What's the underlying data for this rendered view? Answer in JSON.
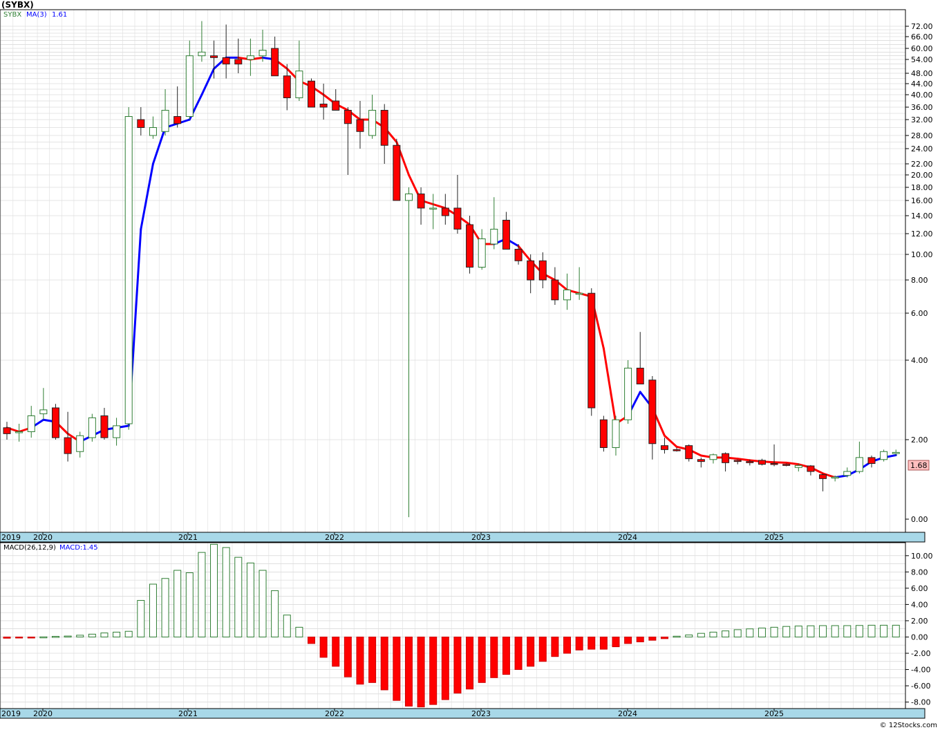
{
  "header": {
    "title": "(SYBX)"
  },
  "footer": {
    "copyright": "© 12Stocks.com"
  },
  "colors": {
    "up": "#2e7d32",
    "down": "#ff0000",
    "ma_up": "#0000ff",
    "ma_down": "#ff0000",
    "price_tag_bg": "#ffc0c0",
    "axis_band": "#a8d8e8",
    "grid": "#cccccc"
  },
  "chart_data": [
    {
      "type": "candlestick",
      "legend_symbol": "SYBX",
      "legend_ma_label": "MA(3)",
      "legend_ma_value": "1.61",
      "last_price_label": "1.68",
      "y_tick_labels": [
        "72.00",
        "66.00",
        "60.00",
        "54.00",
        "48.00",
        "44.00",
        "40.00",
        "36.00",
        "32.00",
        "28.00",
        "24.00",
        "22.00",
        "20.00",
        "18.00",
        "16.00",
        "14.00",
        "12.00",
        "10.00",
        "8.00",
        "6.00",
        "4.00",
        "2.00",
        "0.00"
      ],
      "x_tick_labels": [
        "2019",
        "2020",
        "2021",
        "2022",
        "2023",
        "2024",
        "2025"
      ],
      "grid": true,
      "candles": [
        {
          "o": 2.3,
          "h": 2.45,
          "l": 2.0,
          "c": 2.15
        },
        {
          "o": 2.18,
          "h": 2.4,
          "l": 1.95,
          "c": 2.2
        },
        {
          "o": 2.2,
          "h": 2.85,
          "l": 2.05,
          "c": 2.6
        },
        {
          "o": 2.65,
          "h": 3.3,
          "l": 2.5,
          "c": 2.75
        },
        {
          "o": 2.8,
          "h": 2.9,
          "l": 2.0,
          "c": 2.05
        },
        {
          "o": 2.05,
          "h": 2.7,
          "l": 1.45,
          "c": 1.65
        },
        {
          "o": 1.7,
          "h": 2.2,
          "l": 1.55,
          "c": 2.1
        },
        {
          "o": 2.05,
          "h": 2.65,
          "l": 1.95,
          "c": 2.55
        },
        {
          "o": 2.6,
          "h": 2.8,
          "l": 2.0,
          "c": 2.05
        },
        {
          "o": 2.05,
          "h": 2.55,
          "l": 1.85,
          "c": 2.35
        },
        {
          "o": 2.4,
          "h": 36,
          "l": 2.25,
          "c": 33
        },
        {
          "o": 32,
          "h": 36,
          "l": 28,
          "c": 30
        },
        {
          "o": 28,
          "h": 33,
          "l": 27,
          "c": 30
        },
        {
          "o": 29,
          "h": 42,
          "l": 28,
          "c": 35
        },
        {
          "o": 33,
          "h": 43,
          "l": 30,
          "c": 31
        },
        {
          "o": 33,
          "h": 64,
          "l": 32,
          "c": 56
        },
        {
          "o": 56,
          "h": 75,
          "l": 53,
          "c": 58
        },
        {
          "o": 56,
          "h": 64,
          "l": 46,
          "c": 55
        },
        {
          "o": 55,
          "h": 73,
          "l": 46,
          "c": 52
        },
        {
          "o": 54,
          "h": 65,
          "l": 48,
          "c": 52
        },
        {
          "o": 54,
          "h": 65,
          "l": 47,
          "c": 56
        },
        {
          "o": 56,
          "h": 70,
          "l": 53,
          "c": 59
        },
        {
          "o": 60,
          "h": 66,
          "l": 47,
          "c": 47
        },
        {
          "o": 47,
          "h": 52,
          "l": 35,
          "c": 39
        },
        {
          "o": 39,
          "h": 64,
          "l": 38,
          "c": 49
        },
        {
          "o": 45,
          "h": 46,
          "l": 36,
          "c": 36
        },
        {
          "o": 37,
          "h": 44,
          "l": 32,
          "c": 36
        },
        {
          "o": 38,
          "h": 42,
          "l": 35,
          "c": 35
        },
        {
          "o": 35,
          "h": 36,
          "l": 20,
          "c": 31
        },
        {
          "o": 32,
          "h": 38,
          "l": 24,
          "c": 29
        },
        {
          "o": 28,
          "h": 40,
          "l": 27,
          "c": 35
        },
        {
          "o": 35,
          "h": 37,
          "l": 22,
          "c": 25
        },
        {
          "o": 25,
          "h": 27,
          "l": 16,
          "c": 16
        },
        {
          "o": 16,
          "h": 18,
          "l": 0.05,
          "c": 17
        },
        {
          "o": 17,
          "h": 18,
          "l": 13,
          "c": 15
        },
        {
          "o": 15,
          "h": 17,
          "l": 12.5,
          "c": 15
        },
        {
          "o": 15,
          "h": 17,
          "l": 13,
          "c": 14
        },
        {
          "o": 15,
          "h": 20,
          "l": 12,
          "c": 12.5
        },
        {
          "o": 13,
          "h": 14,
          "l": 8.5,
          "c": 9
        },
        {
          "o": 9,
          "h": 12.5,
          "l": 8.8,
          "c": 11.5
        },
        {
          "o": 11,
          "h": 16.5,
          "l": 10.5,
          "c": 12.5
        },
        {
          "o": 13.5,
          "h": 14.5,
          "l": 10.5,
          "c": 10.5
        },
        {
          "o": 10.5,
          "h": 11,
          "l": 9.2,
          "c": 9.5
        },
        {
          "o": 9.5,
          "h": 10,
          "l": 7.2,
          "c": 8
        },
        {
          "o": 9.5,
          "h": 10.2,
          "l": 7.5,
          "c": 8
        },
        {
          "o": 8,
          "h": 9,
          "l": 6.5,
          "c": 6.8
        },
        {
          "o": 6.8,
          "h": 8.5,
          "l": 6.2,
          "c": 7.4
        },
        {
          "o": 7.2,
          "h": 9,
          "l": 6.8,
          "c": 7.2
        },
        {
          "o": 7.2,
          "h": 7.5,
          "l": 2.6,
          "c": 2.8
        },
        {
          "o": 2.5,
          "h": 2.6,
          "l": 1.7,
          "c": 1.8
        },
        {
          "o": 1.8,
          "h": 2.6,
          "l": 1.6,
          "c": 2.5
        },
        {
          "o": 2.5,
          "h": 4,
          "l": 2.4,
          "c": 3.8
        },
        {
          "o": 3.8,
          "h": 5.2,
          "l": 3.6,
          "c": 3.4
        },
        {
          "o": 3.5,
          "h": 3.6,
          "l": 1.5,
          "c": 1.9
        },
        {
          "o": 1.85,
          "h": 2.05,
          "l": 1.65,
          "c": 1.75
        },
        {
          "o": 1.75,
          "h": 1.8,
          "l": 1.7,
          "c": 1.72
        },
        {
          "o": 1.85,
          "h": 1.88,
          "l": 1.45,
          "c": 1.52
        },
        {
          "o": 1.5,
          "h": 1.55,
          "l": 1.3,
          "c": 1.45
        },
        {
          "o": 1.5,
          "h": 1.65,
          "l": 1.4,
          "c": 1.62
        },
        {
          "o": 1.65,
          "h": 1.68,
          "l": 1.2,
          "c": 1.42
        },
        {
          "o": 1.48,
          "h": 1.5,
          "l": 1.38,
          "c": 1.45
        },
        {
          "o": 1.45,
          "h": 1.5,
          "l": 1.35,
          "c": 1.42
        },
        {
          "o": 1.48,
          "h": 1.52,
          "l": 1.35,
          "c": 1.38
        },
        {
          "o": 1.4,
          "h": 1.88,
          "l": 1.33,
          "c": 1.38
        },
        {
          "o": 1.38,
          "h": 1.4,
          "l": 1.33,
          "c": 1.35
        },
        {
          "o": 1.3,
          "h": 1.4,
          "l": 1.2,
          "c": 1.35
        },
        {
          "o": 1.34,
          "h": 1.36,
          "l": 1.1,
          "c": 1.2
        },
        {
          "o": 1.12,
          "h": 1.15,
          "l": 0.7,
          "c": 1.02
        },
        {
          "o": 1.05,
          "h": 1.1,
          "l": 0.95,
          "c": 1.06
        },
        {
          "o": 1.1,
          "h": 1.3,
          "l": 1.05,
          "c": 1.2
        },
        {
          "o": 1.2,
          "h": 1.95,
          "l": 1.15,
          "c": 1.55
        },
        {
          "o": 1.55,
          "h": 1.6,
          "l": 1.3,
          "c": 1.4
        },
        {
          "o": 1.5,
          "h": 1.75,
          "l": 1.45,
          "c": 1.7
        },
        {
          "o": 1.65,
          "h": 1.75,
          "l": 1.6,
          "c": 1.68
        }
      ],
      "ma3": [
        2.3,
        2.2,
        2.3,
        2.5,
        2.45,
        2.15,
        1.95,
        2.1,
        2.25,
        2.3,
        2.35,
        12.5,
        22,
        30,
        31,
        32,
        40,
        50,
        55,
        55,
        54,
        55,
        54,
        50,
        45,
        43,
        40,
        37,
        35,
        32,
        32,
        30,
        26,
        20,
        16,
        15.5,
        15,
        14,
        13,
        11,
        11,
        11.5,
        10.8,
        9.5,
        8.5,
        8,
        7.4,
        7.2,
        7.0,
        4.5,
        2.4,
        2.6,
        3.2,
        2.8,
        2.1,
        1.82,
        1.75,
        1.6,
        1.55,
        1.55,
        1.52,
        1.48,
        1.45,
        1.43,
        1.42,
        1.38,
        1.3,
        1.15,
        1.05,
        1.1,
        1.25,
        1.45,
        1.55,
        1.61
      ],
      "ma_dir": [
        "down",
        "down",
        "up",
        "up",
        "down",
        "down",
        "up",
        "up",
        "up",
        "up",
        "up",
        "up",
        "up",
        "up",
        "up",
        "up",
        "up",
        "up",
        "up",
        "down",
        "down",
        "up",
        "down",
        "down",
        "down",
        "down",
        "down",
        "down",
        "down",
        "down",
        "down",
        "down",
        "down",
        "down",
        "down",
        "down",
        "down",
        "down",
        "down",
        "down",
        "up",
        "up",
        "down",
        "down",
        "down",
        "down",
        "down",
        "down",
        "down",
        "down",
        "down",
        "up",
        "up",
        "down",
        "down",
        "down",
        "down",
        "down",
        "down",
        "down",
        "down",
        "down",
        "down",
        "down",
        "down",
        "down",
        "down",
        "down",
        "up",
        "up",
        "up",
        "up",
        "up",
        "up"
      ]
    },
    {
      "type": "bar",
      "legend_label": "MACD(26,12,9)",
      "legend_value_label": "MACD:1.45",
      "y_tick_labels": [
        "10.00",
        "8.00",
        "6.00",
        "4.00",
        "2.00",
        "0.00",
        "-2.00",
        "-4.00",
        "-6.00",
        "-8.00"
      ],
      "x_tick_labels": [
        "2019",
        "2020",
        "2021",
        "2022",
        "2023",
        "2024",
        "2025"
      ],
      "ylim": [
        -8.8,
        11.6
      ],
      "values": [
        -0.15,
        -0.12,
        -0.1,
        0.02,
        0.08,
        0.12,
        0.22,
        0.35,
        0.5,
        0.6,
        0.7,
        4.5,
        6.5,
        7.2,
        8.2,
        7.9,
        10.4,
        11.4,
        11.0,
        9.8,
        9.1,
        8.2,
        5.7,
        2.7,
        1.2,
        -0.8,
        -2.5,
        -3.6,
        -4.9,
        -5.8,
        -5.6,
        -6.5,
        -7.8,
        -8.5,
        -8.6,
        -8.3,
        -7.7,
        -6.9,
        -6.4,
        -5.6,
        -5.0,
        -4.6,
        -4.0,
        -3.6,
        -3.0,
        -2.4,
        -2.0,
        -1.6,
        -1.5,
        -1.5,
        -1.2,
        -0.8,
        -0.6,
        -0.4,
        -0.2,
        0.1,
        0.25,
        0.45,
        0.6,
        0.75,
        0.9,
        1.0,
        1.1,
        1.2,
        1.3,
        1.35,
        1.38,
        1.4,
        1.4,
        1.4,
        1.42,
        1.45,
        1.45,
        1.45
      ]
    }
  ]
}
